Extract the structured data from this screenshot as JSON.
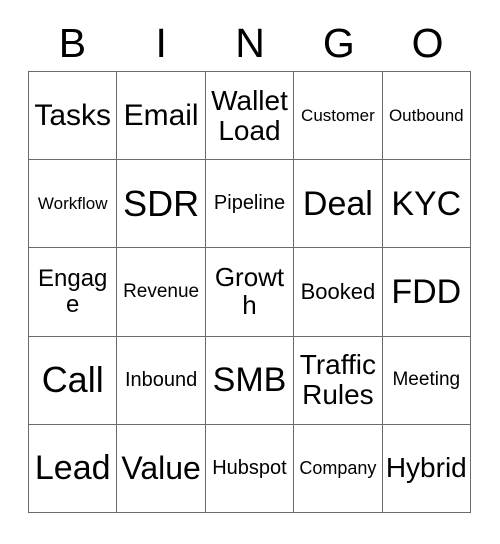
{
  "card": {
    "header_letters": [
      "B",
      "I",
      "N",
      "G",
      "O"
    ],
    "colors": {
      "background": "#ffffff",
      "text": "#000000",
      "grid_line": "#6b6b6b"
    },
    "rows": [
      [
        {
          "text": "Tasks",
          "size": "fs-30"
        },
        {
          "text": "Email",
          "size": "fs-30"
        },
        {
          "text": "Wallet Load",
          "size": "fs-28"
        },
        {
          "text": "Customer",
          "size": "fs-17"
        },
        {
          "text": "Outbound",
          "size": "fs-17"
        }
      ],
      [
        {
          "text": "Workflow",
          "size": "fs-17"
        },
        {
          "text": "SDR",
          "size": "fs-36"
        },
        {
          "text": "Pipeline",
          "size": "fs-20"
        },
        {
          "text": "Deal",
          "size": "fs-34"
        },
        {
          "text": "KYC",
          "size": "fs-34"
        }
      ],
      [
        {
          "text": "Engage",
          "size": "fs-24"
        },
        {
          "text": "Revenue",
          "size": "fs-19"
        },
        {
          "text": "Growth",
          "size": "fs-26"
        },
        {
          "text": "Booked",
          "size": "fs-22"
        },
        {
          "text": "FDD",
          "size": "fs-34"
        }
      ],
      [
        {
          "text": "Call",
          "size": "fs-36"
        },
        {
          "text": "Inbound",
          "size": "fs-20"
        },
        {
          "text": "SMB",
          "size": "fs-34"
        },
        {
          "text": "Traffic Rules",
          "size": "fs-28"
        },
        {
          "text": "Meeting",
          "size": "fs-19"
        }
      ],
      [
        {
          "text": "Lead",
          "size": "fs-34"
        },
        {
          "text": "Value",
          "size": "fs-32"
        },
        {
          "text": "Hubspot",
          "size": "fs-20"
        },
        {
          "text": "Company",
          "size": "fs-18"
        },
        {
          "text": "Hybrid",
          "size": "fs-28"
        }
      ]
    ]
  }
}
